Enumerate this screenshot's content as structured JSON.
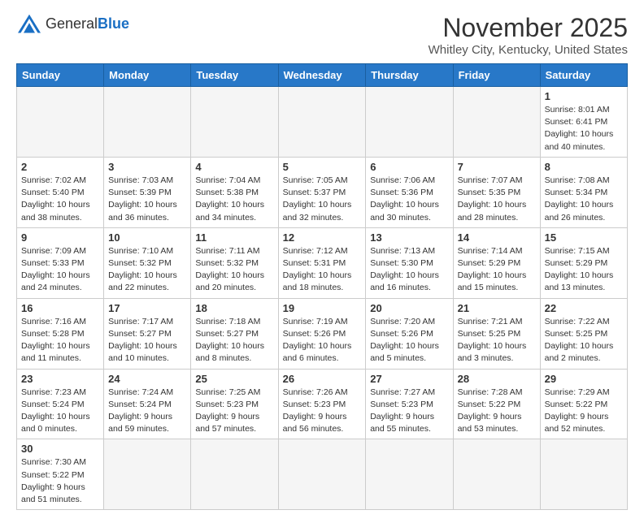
{
  "header": {
    "logo_general": "General",
    "logo_blue": "Blue",
    "month_year": "November 2025",
    "location": "Whitley City, Kentucky, United States"
  },
  "weekdays": [
    "Sunday",
    "Monday",
    "Tuesday",
    "Wednesday",
    "Thursday",
    "Friday",
    "Saturday"
  ],
  "weeks": [
    [
      {
        "day": "",
        "info": ""
      },
      {
        "day": "",
        "info": ""
      },
      {
        "day": "",
        "info": ""
      },
      {
        "day": "",
        "info": ""
      },
      {
        "day": "",
        "info": ""
      },
      {
        "day": "",
        "info": ""
      },
      {
        "day": "1",
        "info": "Sunrise: 8:01 AM\nSunset: 6:41 PM\nDaylight: 10 hours and 40 minutes."
      }
    ],
    [
      {
        "day": "2",
        "info": "Sunrise: 7:02 AM\nSunset: 5:40 PM\nDaylight: 10 hours and 38 minutes."
      },
      {
        "day": "3",
        "info": "Sunrise: 7:03 AM\nSunset: 5:39 PM\nDaylight: 10 hours and 36 minutes."
      },
      {
        "day": "4",
        "info": "Sunrise: 7:04 AM\nSunset: 5:38 PM\nDaylight: 10 hours and 34 minutes."
      },
      {
        "day": "5",
        "info": "Sunrise: 7:05 AM\nSunset: 5:37 PM\nDaylight: 10 hours and 32 minutes."
      },
      {
        "day": "6",
        "info": "Sunrise: 7:06 AM\nSunset: 5:36 PM\nDaylight: 10 hours and 30 minutes."
      },
      {
        "day": "7",
        "info": "Sunrise: 7:07 AM\nSunset: 5:35 PM\nDaylight: 10 hours and 28 minutes."
      },
      {
        "day": "8",
        "info": "Sunrise: 7:08 AM\nSunset: 5:34 PM\nDaylight: 10 hours and 26 minutes."
      }
    ],
    [
      {
        "day": "9",
        "info": "Sunrise: 7:09 AM\nSunset: 5:33 PM\nDaylight: 10 hours and 24 minutes."
      },
      {
        "day": "10",
        "info": "Sunrise: 7:10 AM\nSunset: 5:32 PM\nDaylight: 10 hours and 22 minutes."
      },
      {
        "day": "11",
        "info": "Sunrise: 7:11 AM\nSunset: 5:32 PM\nDaylight: 10 hours and 20 minutes."
      },
      {
        "day": "12",
        "info": "Sunrise: 7:12 AM\nSunset: 5:31 PM\nDaylight: 10 hours and 18 minutes."
      },
      {
        "day": "13",
        "info": "Sunrise: 7:13 AM\nSunset: 5:30 PM\nDaylight: 10 hours and 16 minutes."
      },
      {
        "day": "14",
        "info": "Sunrise: 7:14 AM\nSunset: 5:29 PM\nDaylight: 10 hours and 15 minutes."
      },
      {
        "day": "15",
        "info": "Sunrise: 7:15 AM\nSunset: 5:29 PM\nDaylight: 10 hours and 13 minutes."
      }
    ],
    [
      {
        "day": "16",
        "info": "Sunrise: 7:16 AM\nSunset: 5:28 PM\nDaylight: 10 hours and 11 minutes."
      },
      {
        "day": "17",
        "info": "Sunrise: 7:17 AM\nSunset: 5:27 PM\nDaylight: 10 hours and 10 minutes."
      },
      {
        "day": "18",
        "info": "Sunrise: 7:18 AM\nSunset: 5:27 PM\nDaylight: 10 hours and 8 minutes."
      },
      {
        "day": "19",
        "info": "Sunrise: 7:19 AM\nSunset: 5:26 PM\nDaylight: 10 hours and 6 minutes."
      },
      {
        "day": "20",
        "info": "Sunrise: 7:20 AM\nSunset: 5:26 PM\nDaylight: 10 hours and 5 minutes."
      },
      {
        "day": "21",
        "info": "Sunrise: 7:21 AM\nSunset: 5:25 PM\nDaylight: 10 hours and 3 minutes."
      },
      {
        "day": "22",
        "info": "Sunrise: 7:22 AM\nSunset: 5:25 PM\nDaylight: 10 hours and 2 minutes."
      }
    ],
    [
      {
        "day": "23",
        "info": "Sunrise: 7:23 AM\nSunset: 5:24 PM\nDaylight: 10 hours and 0 minutes."
      },
      {
        "day": "24",
        "info": "Sunrise: 7:24 AM\nSunset: 5:24 PM\nDaylight: 9 hours and 59 minutes."
      },
      {
        "day": "25",
        "info": "Sunrise: 7:25 AM\nSunset: 5:23 PM\nDaylight: 9 hours and 57 minutes."
      },
      {
        "day": "26",
        "info": "Sunrise: 7:26 AM\nSunset: 5:23 PM\nDaylight: 9 hours and 56 minutes."
      },
      {
        "day": "27",
        "info": "Sunrise: 7:27 AM\nSunset: 5:23 PM\nDaylight: 9 hours and 55 minutes."
      },
      {
        "day": "28",
        "info": "Sunrise: 7:28 AM\nSunset: 5:22 PM\nDaylight: 9 hours and 53 minutes."
      },
      {
        "day": "29",
        "info": "Sunrise: 7:29 AM\nSunset: 5:22 PM\nDaylight: 9 hours and 52 minutes."
      }
    ],
    [
      {
        "day": "30",
        "info": "Sunrise: 7:30 AM\nSunset: 5:22 PM\nDaylight: 9 hours and 51 minutes."
      },
      {
        "day": "",
        "info": ""
      },
      {
        "day": "",
        "info": ""
      },
      {
        "day": "",
        "info": ""
      },
      {
        "day": "",
        "info": ""
      },
      {
        "day": "",
        "info": ""
      },
      {
        "day": "",
        "info": ""
      }
    ]
  ]
}
